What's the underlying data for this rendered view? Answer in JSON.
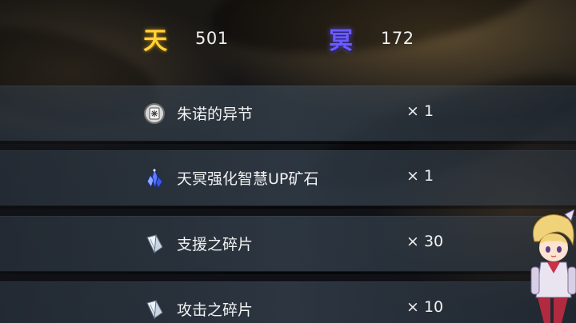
{
  "currencies": {
    "heaven": {
      "glyph": "天",
      "value": "501",
      "color": "#ffd23a"
    },
    "underworld": {
      "glyph": "冥",
      "value": "172",
      "color": "#6a5cff"
    }
  },
  "rewards": [
    {
      "icon": "scroll-icon",
      "name": "朱诺的异节",
      "qty": "× 1"
    },
    {
      "icon": "blue-crystal-icon",
      "name": "天冥强化智慧UP矿石",
      "qty": "× 1"
    },
    {
      "icon": "shard-icon",
      "name": "支援之碎片",
      "qty": "× 30"
    },
    {
      "icon": "shard-icon",
      "name": "攻击之碎片",
      "qty": "× 10"
    }
  ]
}
